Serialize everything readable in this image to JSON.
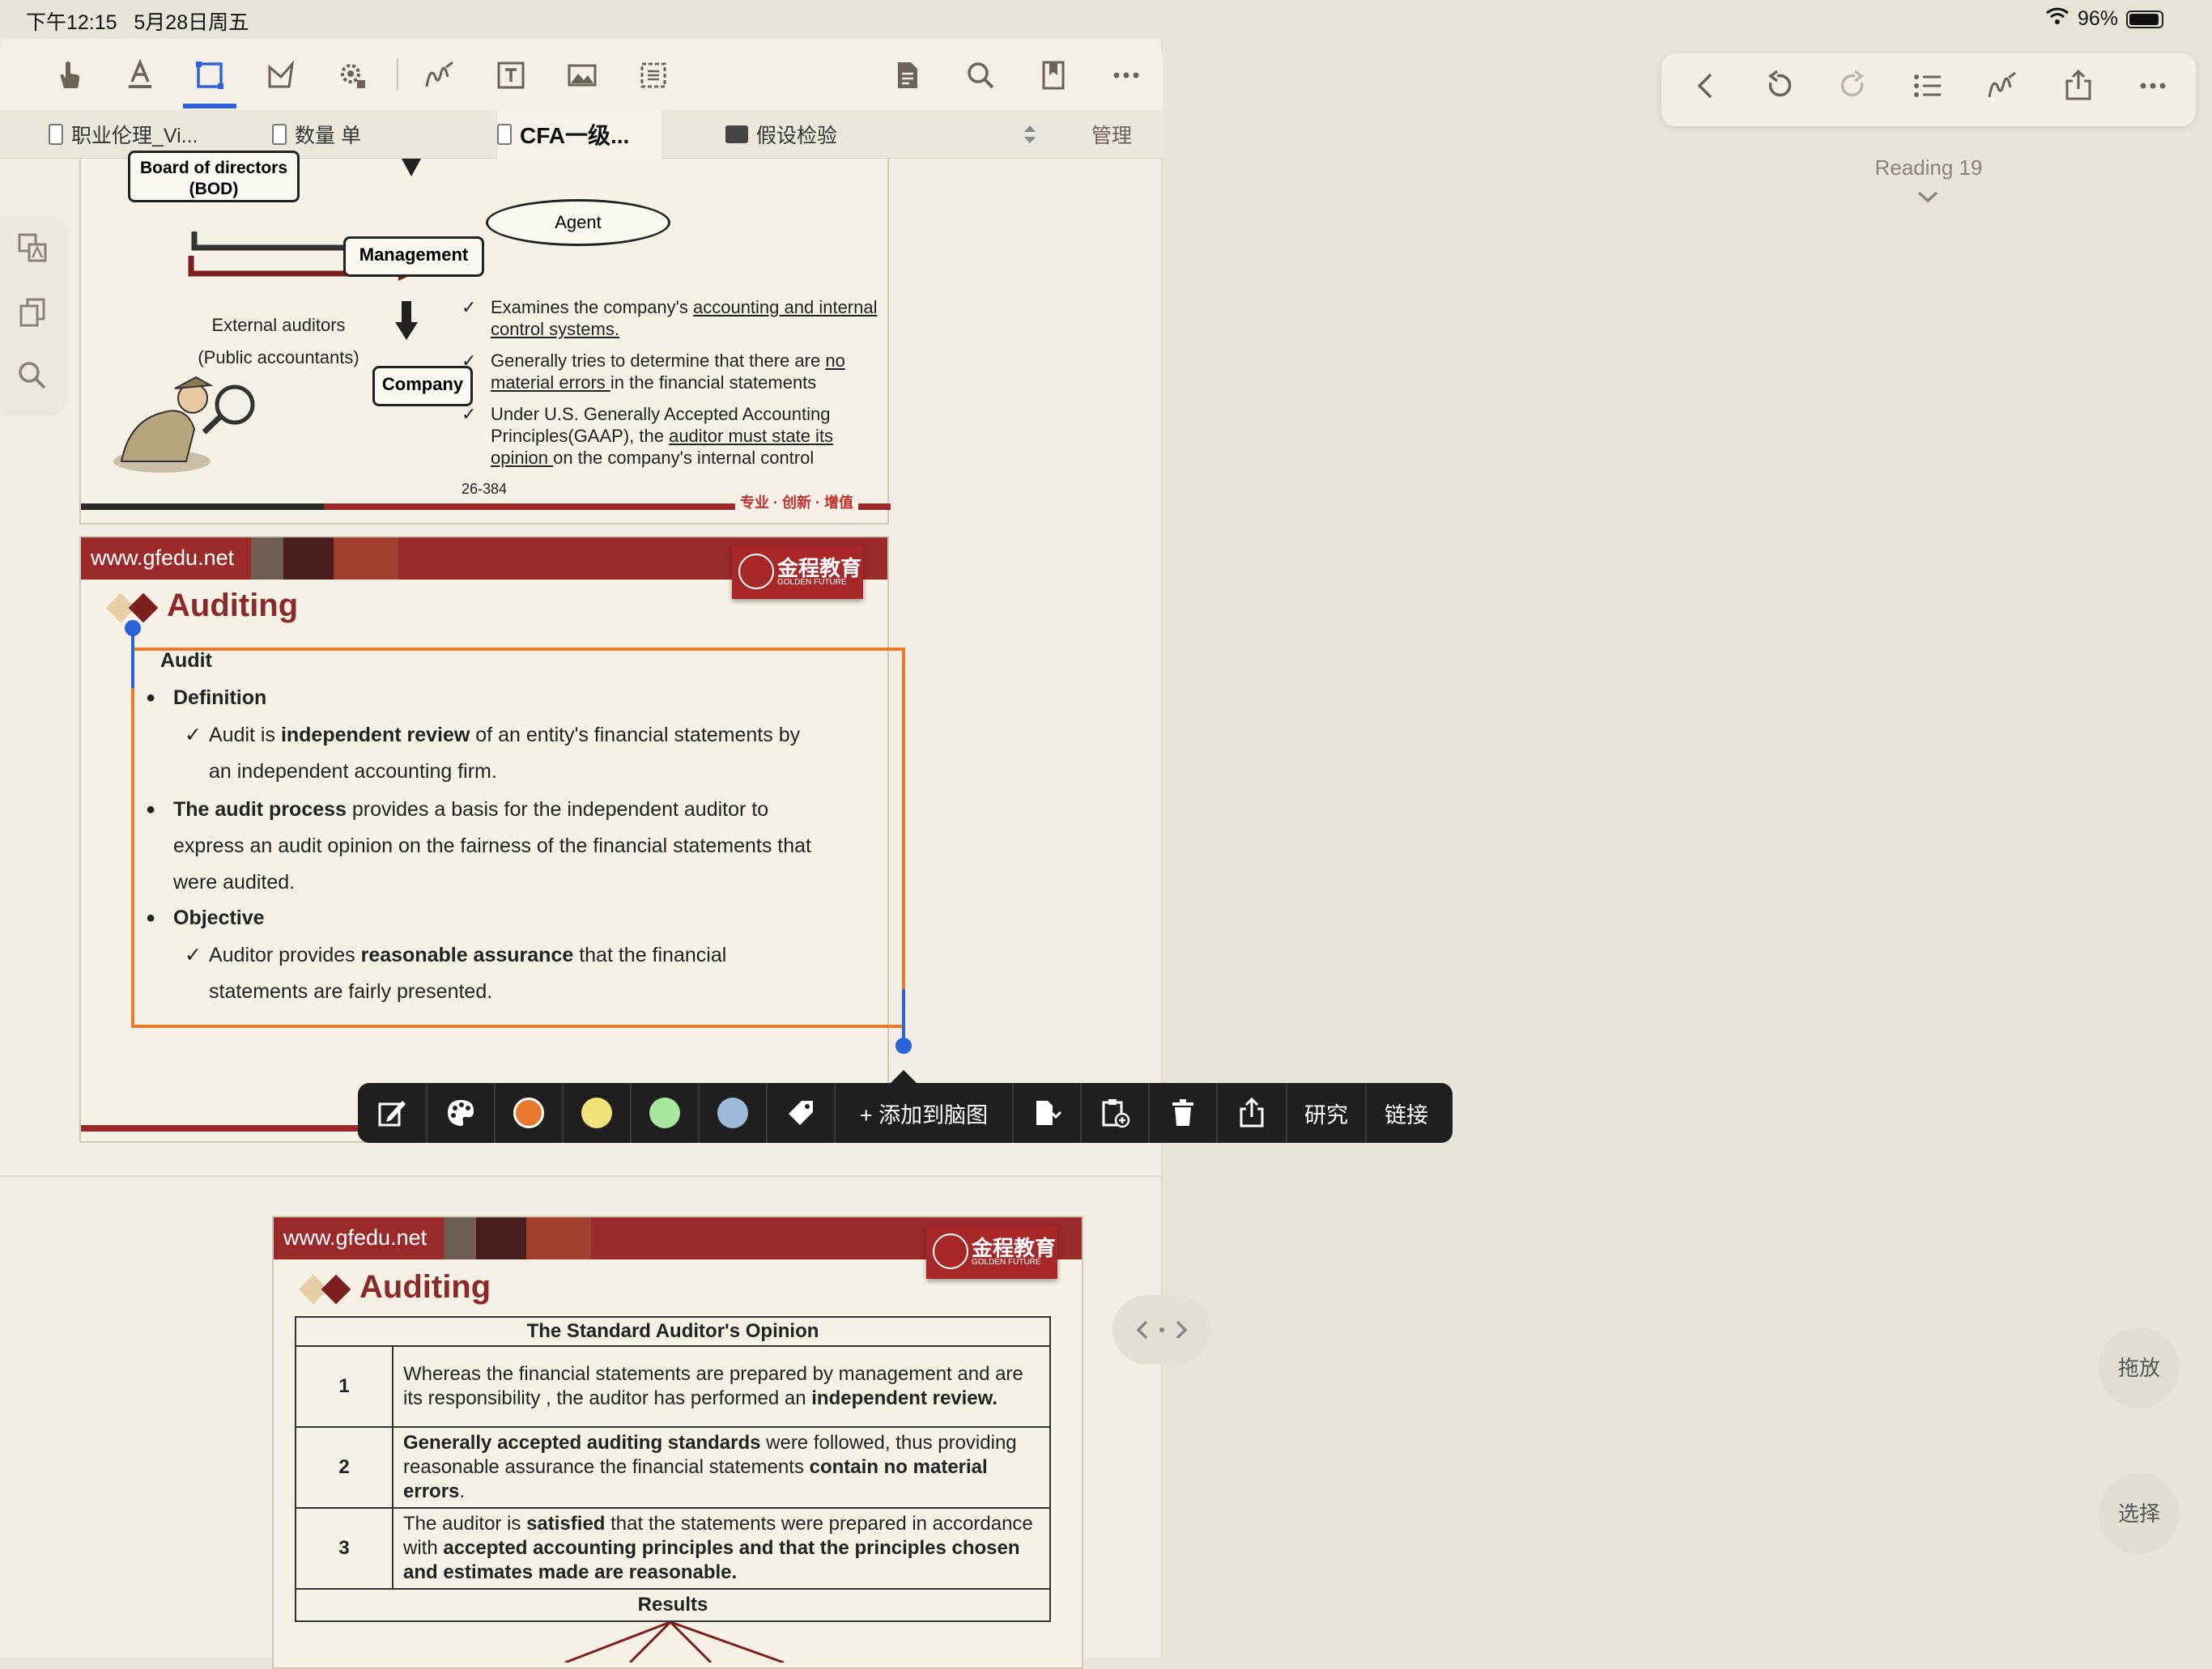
{
  "status_bar": {
    "time": "下午12:15",
    "date": "5月28日周五",
    "battery": "96%"
  },
  "toolbar": {
    "tools": [
      "hand-icon",
      "highlighter-icon",
      "rect-select-icon",
      "shape-icon",
      "settings-icon",
      "pen-icon",
      "text-box-icon",
      "image-icon",
      "crop-icon"
    ],
    "right_tools": [
      "document-icon",
      "search-icon",
      "bookmark-icon",
      "more-icon"
    ]
  },
  "tabs": [
    {
      "label": "职业伦理_Vi..."
    },
    {
      "label": "数量 单"
    },
    {
      "label": "CFA一级..."
    },
    {
      "label": "假设检验"
    }
  ],
  "tabs_manage": "管理",
  "page1": {
    "board": "Board of directors (BOD)",
    "agent": "Agent",
    "management": "Management",
    "company": "Company",
    "external": "External auditors",
    "public": "(Public accountants)",
    "check1a": "Examines the company's ",
    "check1b": "accounting and internal control systems.",
    "check2a": "Generally tries to determine that there are ",
    "check2b": "no material errors ",
    "check2c": "in the financial statements",
    "check3a": "Under U.S. Generally Accepted Accounting Principles(GAAP), the ",
    "check3b": "auditor must state its opinion ",
    "check3c": "on the company's internal control",
    "pagenum": "26-384",
    "slogan": "专业 · 创新 · 增值"
  },
  "page2": {
    "url": "www.gfedu.net",
    "logo_cn": "金程教育",
    "logo_en": "GOLDEN FUTURE",
    "title": "Auditing",
    "audit": "Audit",
    "definition": "Definition",
    "def_a": "Audit is ",
    "def_b": "independent review",
    "def_c": " of an entity's financial statements by",
    "def_d": "an independent accounting firm.",
    "proc_a": "The audit process",
    "proc_b": " provides a basis for the independent auditor to",
    "proc_c": "express an audit opinion on the fairness of the financial statements that",
    "proc_d": "were audited.",
    "objective": "Objective",
    "obj_a": "Auditor provides ",
    "obj_b": "reasonable assurance",
    "obj_c": " that the  financial",
    "obj_d": "statements are fairly presented."
  },
  "popup": {
    "colors": [
      "#e8782e",
      "#f2e27a",
      "#a8e6a0",
      "#9fb9d8"
    ],
    "add_mindmap": "+ 添加到脑图",
    "research": "研究",
    "link": "链接"
  },
  "page3": {
    "url": "www.gfedu.net",
    "logo_cn": "金程教育",
    "logo_en": "GOLDEN FUTURE",
    "title": "Auditing",
    "table_title": "The Standard Auditor's Opinion",
    "rows": [
      {
        "num": "1",
        "a": "Whereas the financial statements are prepared by management and are its responsibility , the auditor has performed an ",
        "b": "independent review."
      },
      {
        "num": "2",
        "a": "Generally accepted auditing standards",
        "b": " were followed, thus providing reasonable assurance the financial statements ",
        "c": "contain no material errors",
        "d": "."
      },
      {
        "num": "3",
        "a": "The auditor is ",
        "b": "satisfied",
        "c": " that the statements were prepared in accordance with ",
        "d": "accepted accounting principles and that the principles chosen and estimates made are reasonable."
      }
    ],
    "results": "Results"
  },
  "right_panel": {
    "reading": "Reading 19",
    "drag_btn": "拖放",
    "select_btn": "选择"
  }
}
